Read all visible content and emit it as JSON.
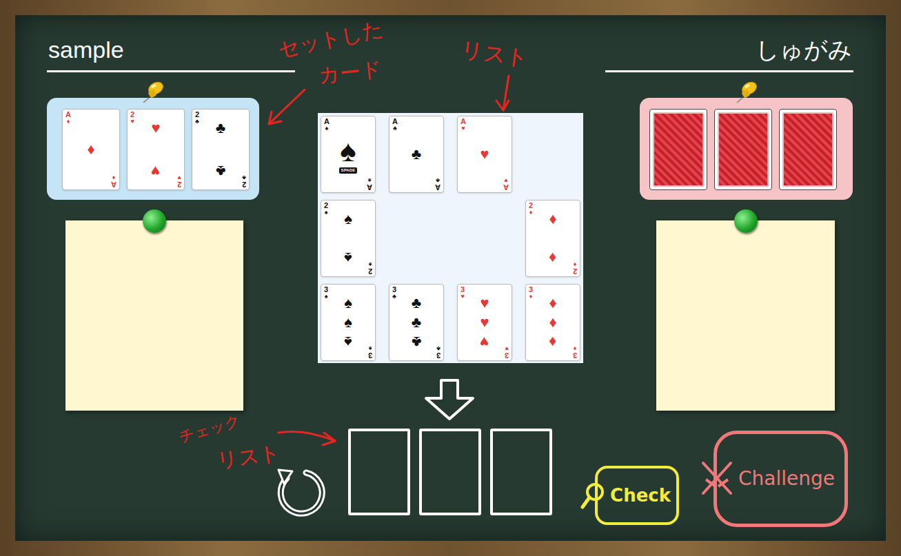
{
  "players": [
    {
      "name": "sample",
      "set_cards": [
        {
          "face_down": false,
          "rank": "A",
          "suit": "♦"
        },
        {
          "face_down": false,
          "rank": "2",
          "suit": "♥"
        },
        {
          "face_down": false,
          "rank": "2",
          "suit": "♣"
        }
      ]
    },
    {
      "name": "しゅがみ",
      "set_cards": [
        {
          "face_down": true
        },
        {
          "face_down": true
        },
        {
          "face_down": true
        }
      ]
    }
  ],
  "list": {
    "rows": [
      [
        {
          "empty": false,
          "rank": "A",
          "suit": "♠",
          "banner": "SPADE"
        },
        {
          "empty": false,
          "rank": "A",
          "suit": "♣"
        },
        {
          "empty": false,
          "rank": "A",
          "suit": "♥"
        },
        {
          "empty": true
        }
      ],
      [
        {
          "empty": false,
          "rank": "2",
          "suit": "♠"
        },
        {
          "empty": true
        },
        {
          "empty": true
        },
        {
          "empty": false,
          "rank": "2",
          "suit": "♦"
        }
      ],
      [
        {
          "empty": false,
          "rank": "3",
          "suit": "♠"
        },
        {
          "empty": false,
          "rank": "3",
          "suit": "♣"
        },
        {
          "empty": false,
          "rank": "3",
          "suit": "♥"
        },
        {
          "empty": false,
          "rank": "3",
          "suit": "♦"
        }
      ]
    ]
  },
  "check_list": {
    "slots": [
      {
        "empty": true
      },
      {
        "empty": true
      },
      {
        "empty": true
      }
    ]
  },
  "buttons": {
    "check": "Check",
    "challenge": "Challenge"
  },
  "annotations": [
    {
      "lines": [
        "セットした",
        "カード"
      ]
    },
    {
      "lines": [
        "リスト"
      ]
    },
    {
      "lines": [
        "チェック",
        "リスト"
      ]
    }
  ]
}
